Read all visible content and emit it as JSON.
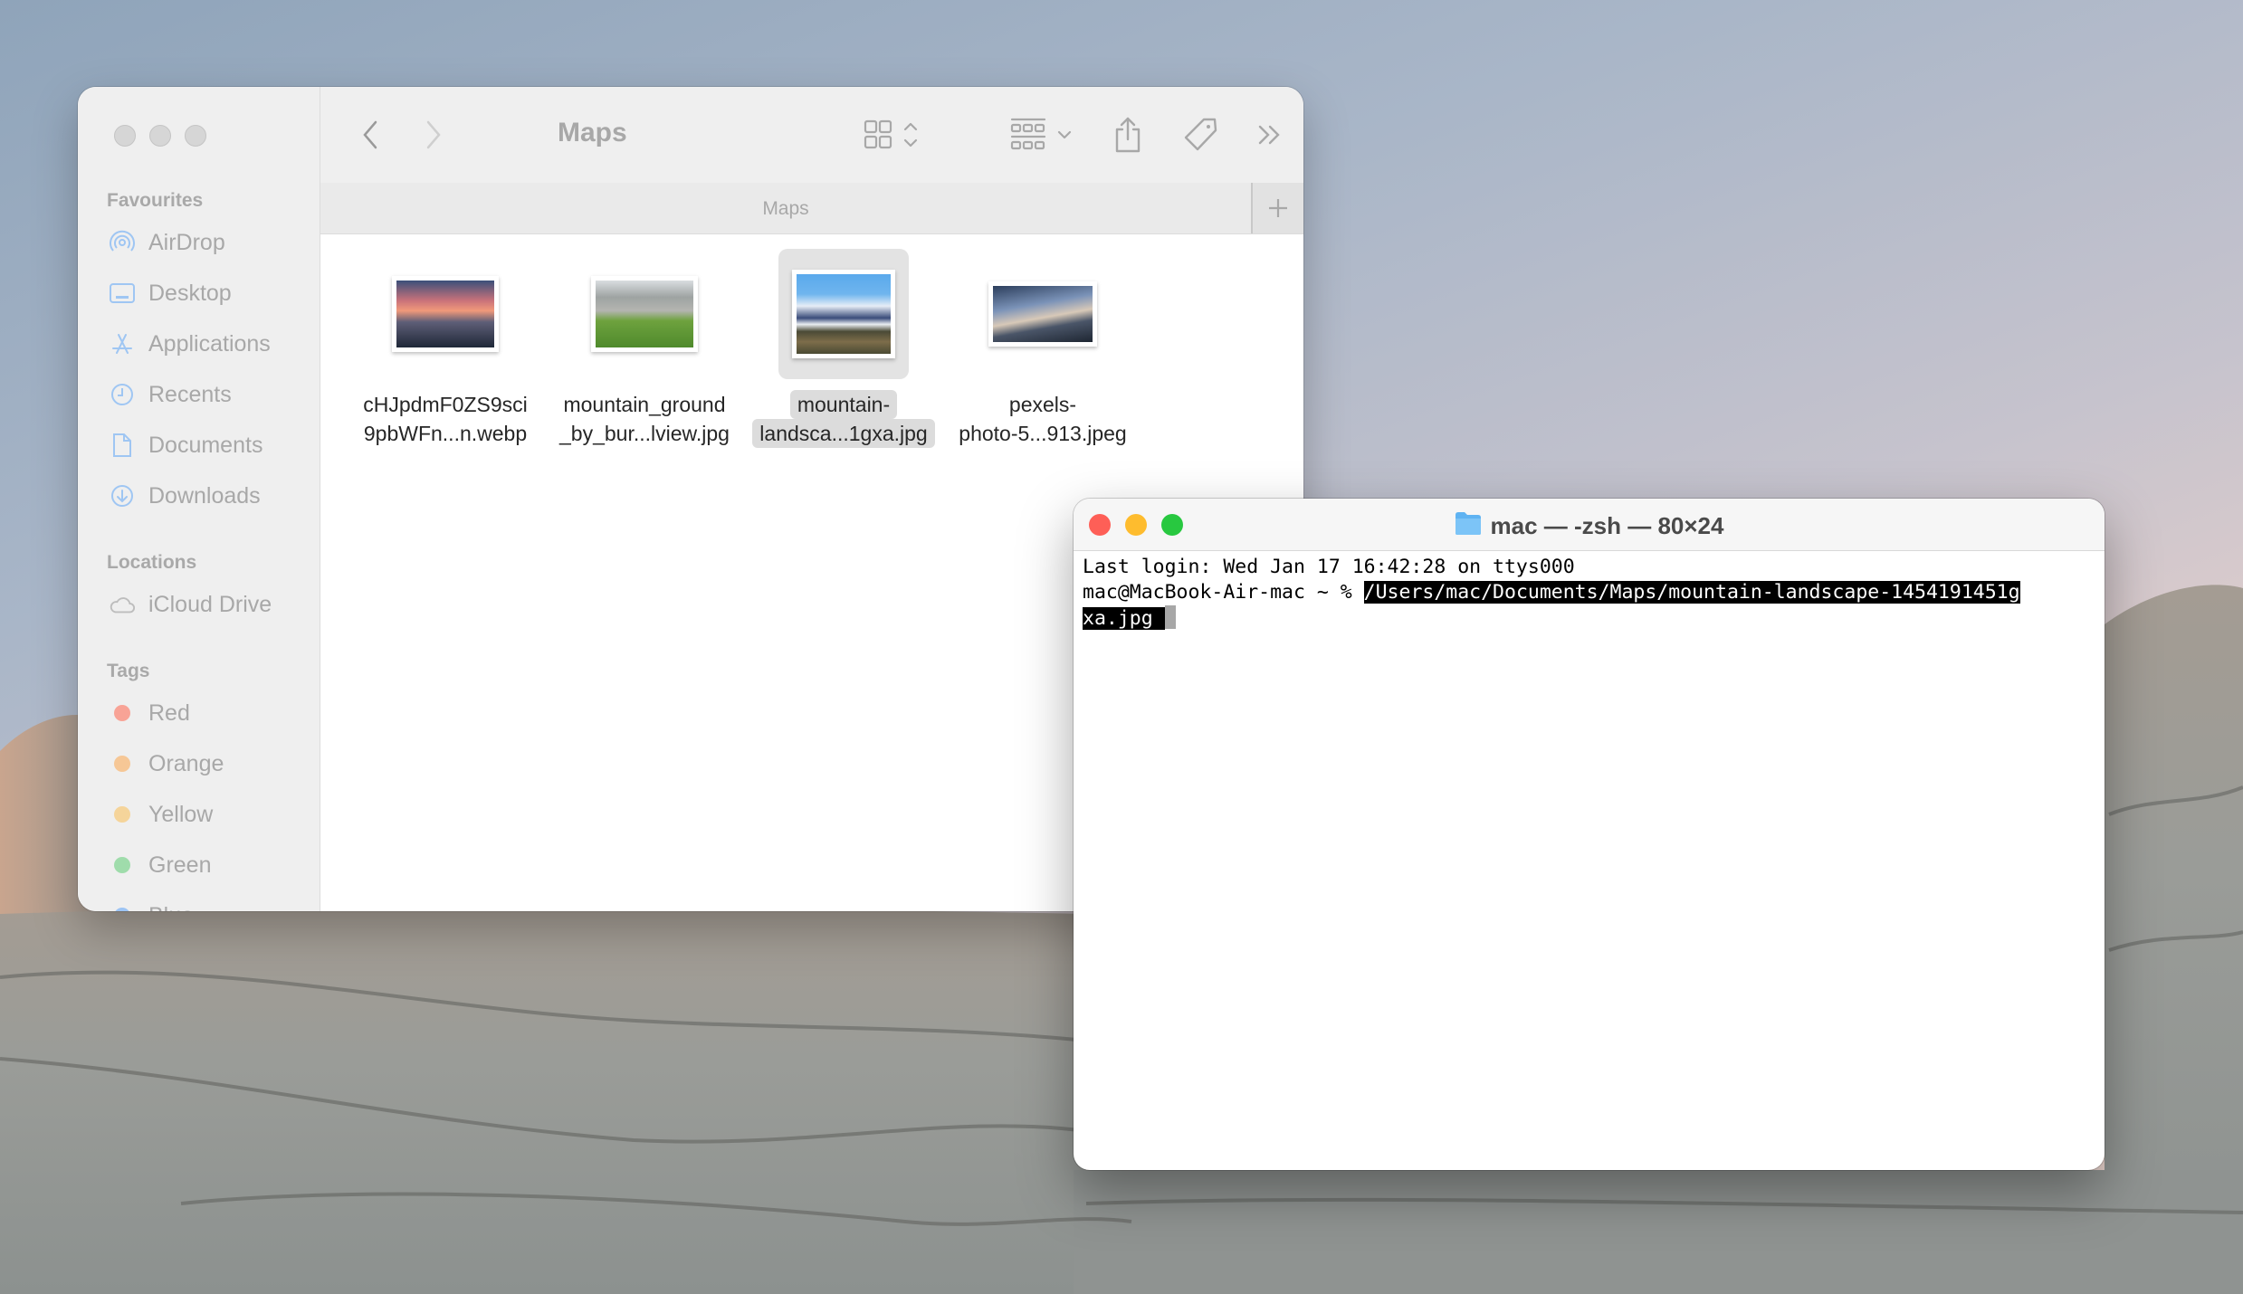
{
  "desktop": {
    "wallpaper": "rock formations at dusk"
  },
  "finder": {
    "window_title": "Maps",
    "tab_title": "Maps",
    "traffic_lights": [
      "close",
      "minimize",
      "zoom"
    ],
    "toolbar": {
      "back_icon": "chevron-left-icon",
      "forward_icon": "chevron-right-icon",
      "view_icon": "grid-view-icon",
      "group_icon": "group-by-icon",
      "share_icon": "share-icon",
      "tag_icon": "tag-icon",
      "more_icon": "double-chevron-icon",
      "search_icon": "search-icon",
      "new_tab_label": "+"
    },
    "sidebar": {
      "favourites_header": "Favourites",
      "favourites": [
        {
          "label": "AirDrop",
          "icon": "airdrop-icon"
        },
        {
          "label": "Desktop",
          "icon": "desktop-icon"
        },
        {
          "label": "Applications",
          "icon": "applications-icon"
        },
        {
          "label": "Recents",
          "icon": "clock-icon"
        },
        {
          "label": "Documents",
          "icon": "document-icon"
        },
        {
          "label": "Downloads",
          "icon": "download-icon"
        }
      ],
      "locations_header": "Locations",
      "locations": [
        {
          "label": "iCloud Drive",
          "icon": "cloud-icon"
        }
      ],
      "tags_header": "Tags",
      "tags": [
        {
          "label": "Red",
          "color": "#f8a396"
        },
        {
          "label": "Orange",
          "color": "#f6c796"
        },
        {
          "label": "Yellow",
          "color": "#f5d49a"
        },
        {
          "label": "Green",
          "color": "#9fdcab"
        },
        {
          "label": "Blue",
          "color": "#9dc4f4"
        }
      ]
    },
    "files": [
      {
        "line1": "cHJpdmF0ZS9sci",
        "line2": "9pbWFn...n.webp",
        "selected": false
      },
      {
        "line1": "mountain_ground",
        "line2": "_by_bur...lview.jpg",
        "selected": false
      },
      {
        "line1": "mountain-",
        "line2": "landsca...1gxa.jpg",
        "selected": true
      },
      {
        "line1": "pexels-",
        "line2": "photo-5...913.jpeg",
        "selected": false
      }
    ]
  },
  "terminal": {
    "title": "mac — -zsh — 80×24",
    "traffic_colors": {
      "close": "#fe5f57",
      "minimize": "#febc2e",
      "zoom": "#28c840"
    },
    "lines": {
      "last_login": "Last login: Wed Jan 17 16:42:28 on ttys000",
      "prompt": "mac@MacBook-Air-mac ~ % ",
      "command_part1": "/Users/mac/Documents/Maps/mountain-landscape-1454191451g",
      "command_part2": "xa.jpg "
    }
  }
}
